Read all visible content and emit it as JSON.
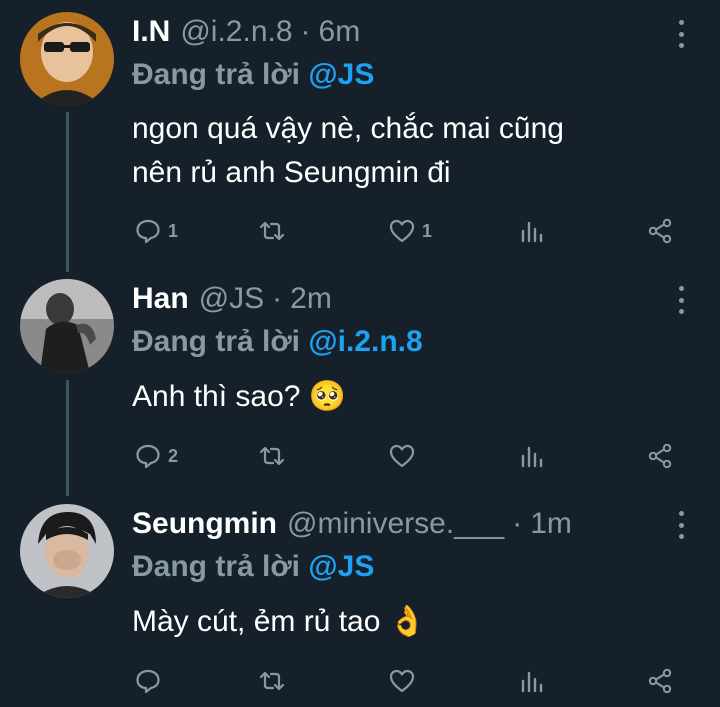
{
  "reply_prefix": "Đang trả lời",
  "tweets": [
    {
      "name": "I.N",
      "handle": "@i.2.n.8",
      "separator": "·",
      "time": "6m",
      "reply_to": "@JS",
      "text_line1": "ngon quá vậy nè, chắc mai cũng",
      "text_line2": "nên rủ anh Seungmin đi",
      "reply_count": "1",
      "retweet_count": "",
      "like_count": "1"
    },
    {
      "name": "Han",
      "handle": "@JS",
      "separator": "·",
      "time": "2m",
      "reply_to": "@i.2.n.8",
      "text": "Anh thì sao? 🥺",
      "reply_count": "2",
      "retweet_count": "",
      "like_count": ""
    },
    {
      "name": "Seungmin",
      "handle": "@miniverse.___",
      "separator": "·",
      "time": "1m",
      "reply_to": "@JS",
      "text": "Mày cút, ẻm rủ tao 👌",
      "reply_count": "",
      "retweet_count": "",
      "like_count": ""
    }
  ],
  "colors": {
    "background": "#15202b",
    "muted": "#8899a6",
    "mention": "#1da1f2",
    "thread_line": "#3d5466"
  },
  "icons": [
    "reply-icon",
    "retweet-icon",
    "like-icon",
    "analytics-icon",
    "share-icon",
    "more-icon"
  ]
}
